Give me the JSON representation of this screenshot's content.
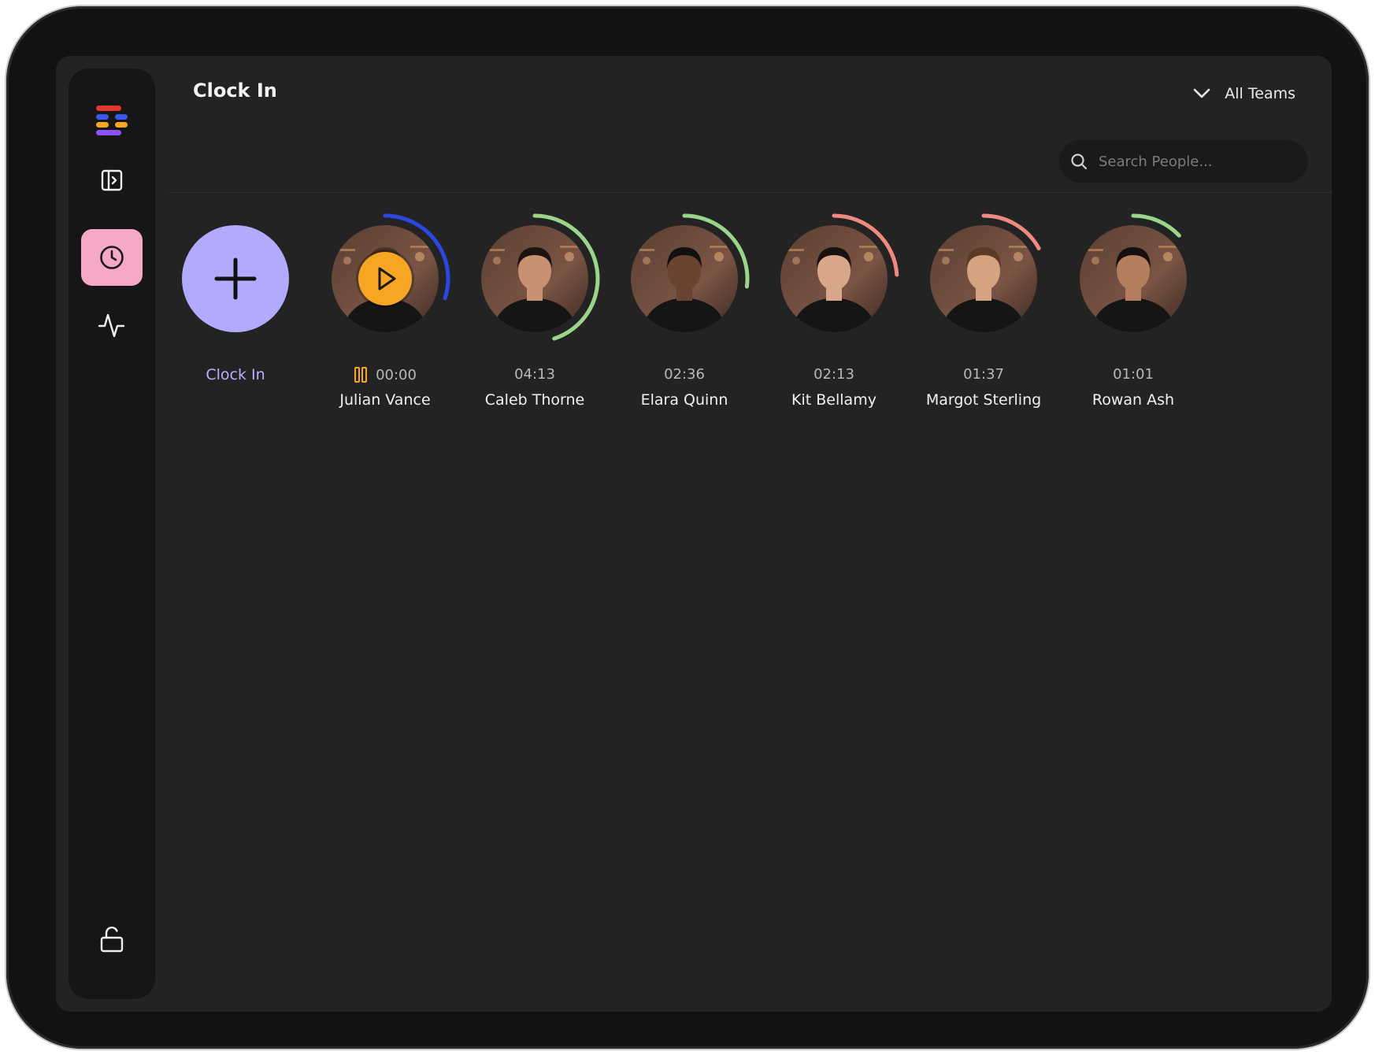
{
  "header": {
    "title": "Clock In",
    "team_select": "All Teams"
  },
  "search": {
    "placeholder": "Search People..."
  },
  "clock_in_button": {
    "label": "Clock In",
    "color": "#b2aafc"
  },
  "sidebar": {
    "items": [
      {
        "name": "logo",
        "icon": "stacked-bars-logo"
      },
      {
        "name": "toggle-sidebar",
        "icon": "sidebar-expand-icon"
      },
      {
        "name": "clock",
        "icon": "clock-icon",
        "active": true,
        "active_color": "#f7a8c6"
      },
      {
        "name": "activity",
        "icon": "activity-pulse-icon"
      },
      {
        "name": "lock",
        "icon": "unlock-icon"
      }
    ]
  },
  "people": [
    {
      "name": "Julian Vance",
      "time": "00:00",
      "paused": true,
      "ring_color": "#2b47e0",
      "ring_fraction": 0.3
    },
    {
      "name": "Caleb Thorne",
      "time": "04:13",
      "paused": false,
      "ring_color": "#9ad58a",
      "ring_fraction": 0.45
    },
    {
      "name": "Elara Quinn",
      "time": "02:36",
      "paused": false,
      "ring_color": "#9ad58a",
      "ring_fraction": 0.27
    },
    {
      "name": "Kit Bellamy",
      "time": "02:13",
      "paused": false,
      "ring_color": "#ef8a80",
      "ring_fraction": 0.24
    },
    {
      "name": "Margot Sterling",
      "time": "01:37",
      "paused": false,
      "ring_color": "#ef8a80",
      "ring_fraction": 0.17
    },
    {
      "name": "Rowan Ash",
      "time": "01:01",
      "paused": false,
      "ring_color": "#9ad58a",
      "ring_fraction": 0.13
    }
  ],
  "colors": {
    "pause_icon": "#f6a623",
    "play_badge": "#f6a623"
  }
}
